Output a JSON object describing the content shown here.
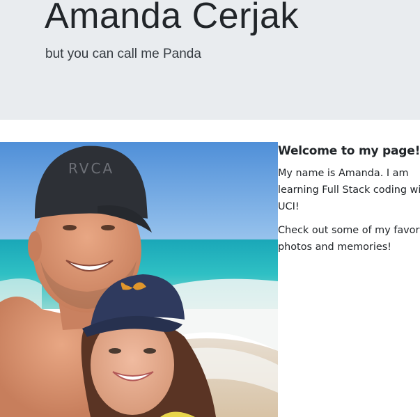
{
  "header": {
    "name": "Amanda Cerjak",
    "tagline": "but you can call me Panda"
  },
  "photo": {
    "hat_text": "RVCA"
  },
  "intro": {
    "heading": "Welcome to my page!",
    "paragraph1": "My name is Amanda. I am learning Full Stack coding with UCI!",
    "paragraph2": "Check out some of my favorite photos and memories!"
  },
  "colors": {
    "header_bg": "#e9ecef",
    "text": "#212529"
  }
}
